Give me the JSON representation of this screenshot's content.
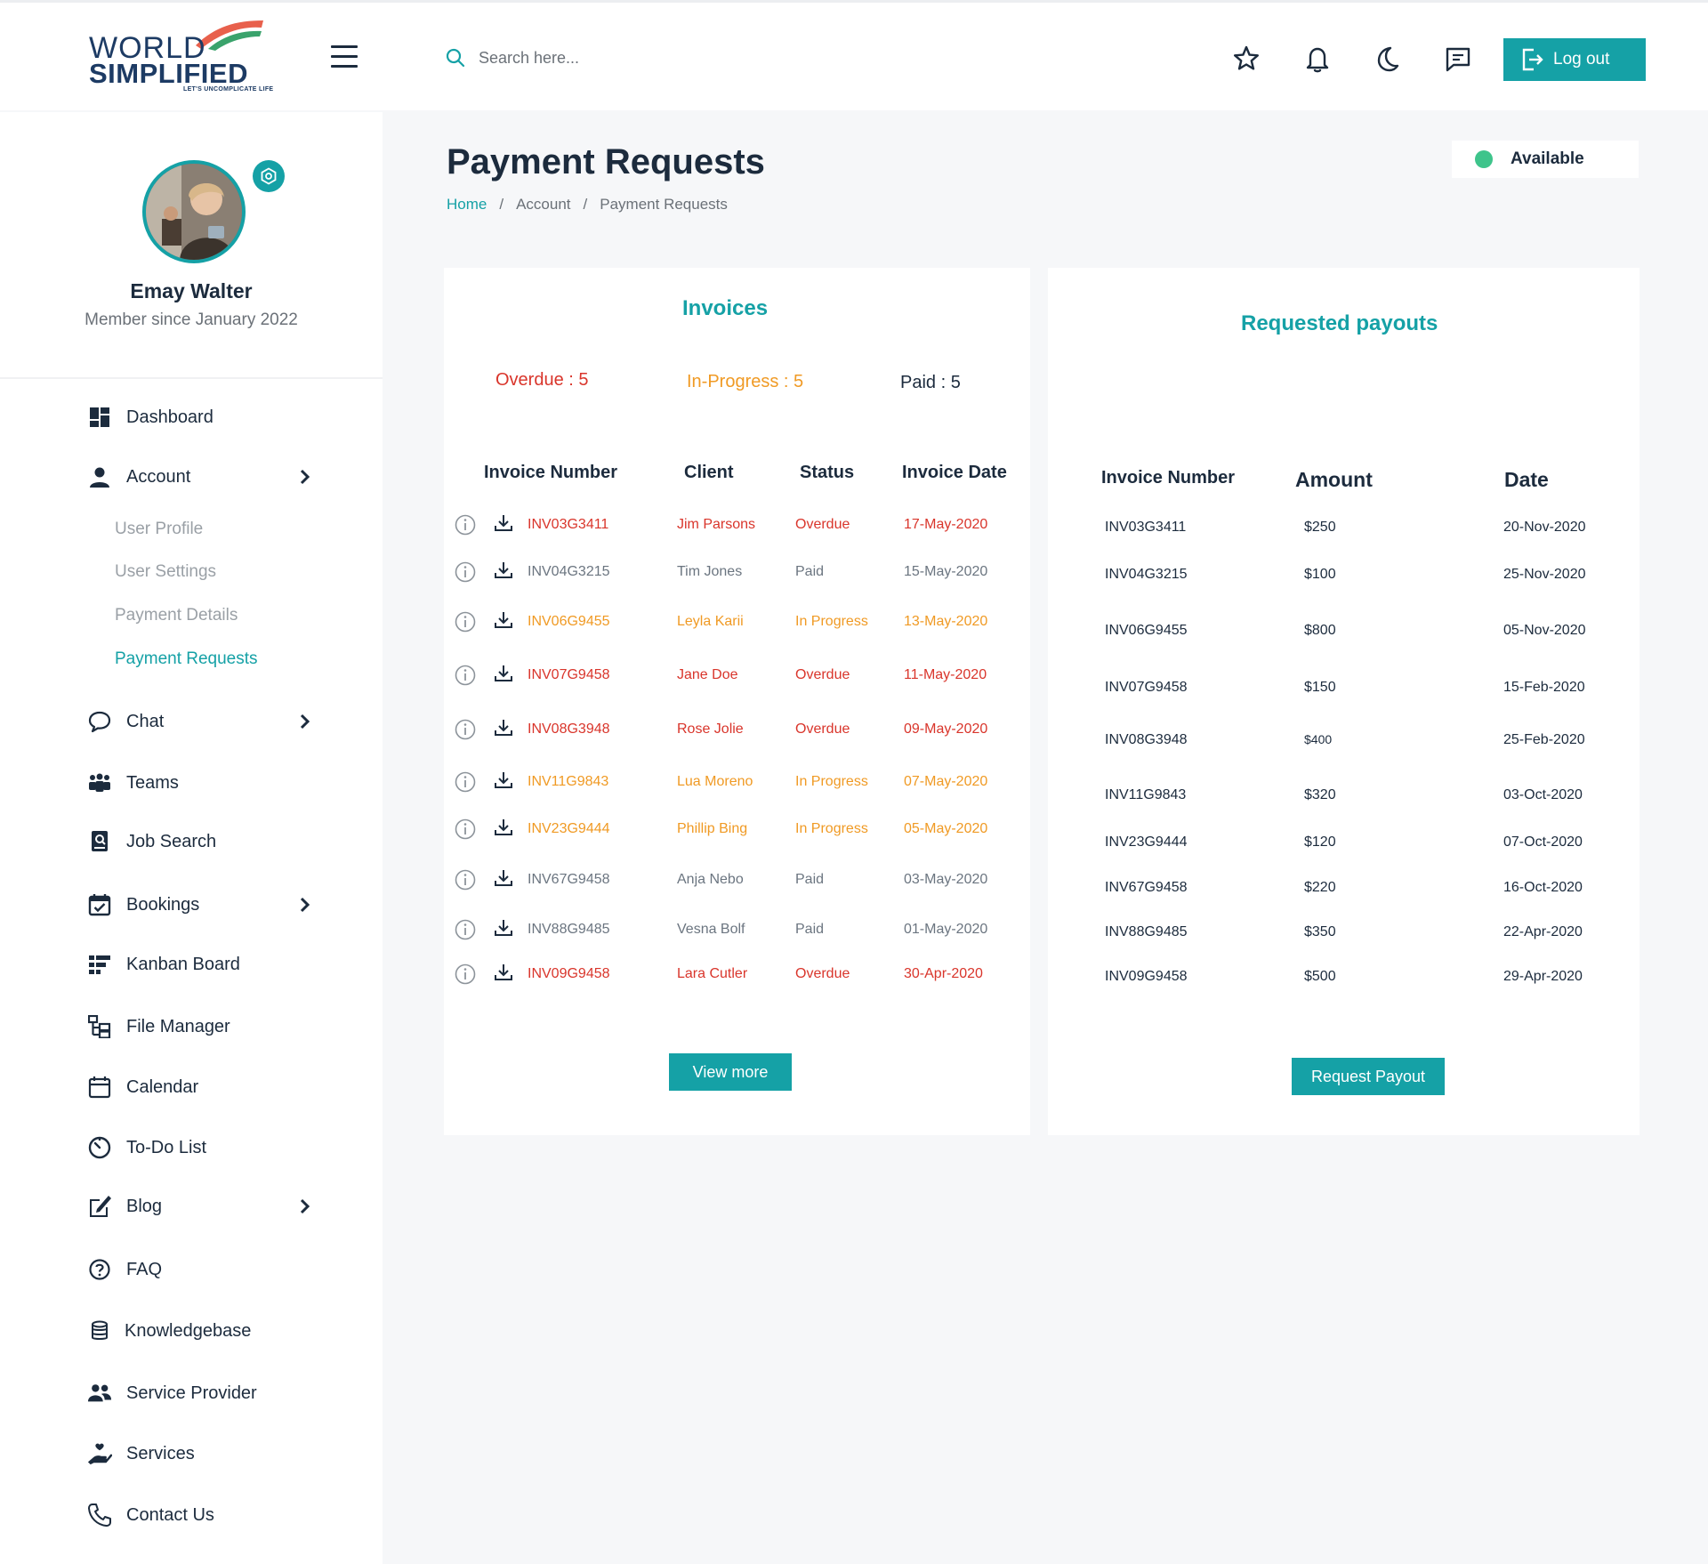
{
  "header": {
    "logo_world": "WORLD",
    "logo_simplified": "SIMPLIFIED",
    "logo_tagline": "LET'S UNCOMPLICATE LIFE",
    "search_placeholder": "Search here...",
    "logout_label": "Log out",
    "icons": [
      "menu-icon",
      "search-icon",
      "star-icon",
      "bell-icon",
      "moon-icon",
      "message-icon",
      "logout-icon"
    ]
  },
  "user": {
    "name": "Emay Walter",
    "since": "Member since January 2022"
  },
  "sidebar": {
    "items": [
      {
        "label": "Dashboard",
        "icon": "dashboard-icon"
      },
      {
        "label": "Account",
        "icon": "user-icon"
      },
      {
        "label": "Chat",
        "icon": "chat-icon"
      },
      {
        "label": "Teams",
        "icon": "teams-icon"
      },
      {
        "label": "Job Search",
        "icon": "job-search-icon"
      },
      {
        "label": "Bookings",
        "icon": "calendar-check-icon"
      },
      {
        "label": "Kanban Board",
        "icon": "kanban-icon"
      },
      {
        "label": "File Manager",
        "icon": "file-tree-icon"
      },
      {
        "label": "Calendar",
        "icon": "calendar-icon"
      },
      {
        "label": "To-Do List",
        "icon": "timer-icon"
      },
      {
        "label": "Blog",
        "icon": "edit-icon"
      },
      {
        "label": "FAQ",
        "icon": "help-icon"
      },
      {
        "label": "Knowledgebase",
        "icon": "database-icon"
      },
      {
        "label": "Service Provider",
        "icon": "people-icon"
      },
      {
        "label": "Services",
        "icon": "hand-heart-icon"
      },
      {
        "label": "Contact Us",
        "icon": "phone-icon"
      }
    ],
    "account_sub": [
      "User Profile",
      "User Settings",
      "Payment Details",
      "Payment Requests"
    ]
  },
  "page": {
    "title": "Payment Requests",
    "breadcrumb": [
      "Home",
      "Account",
      "Payment Requests"
    ],
    "status": "Available"
  },
  "invoices": {
    "title": "Invoices",
    "counts": {
      "overdue": "Overdue  : 5",
      "in_progress": "In-Progress : 5",
      "paid": "Paid  : 5"
    },
    "headers": [
      "Invoice Number",
      "Client",
      "Status",
      "Invoice Date"
    ],
    "rows": [
      {
        "number": "INV03G3411",
        "client": "Jim Parsons",
        "status": "Overdue",
        "date": "17-May-2020",
        "kind": "overdue"
      },
      {
        "number": "INV04G3215",
        "client": "Tim Jones",
        "status": "Paid",
        "date": "15-May-2020",
        "kind": "paid"
      },
      {
        "number": "INV06G9455",
        "client": "Leyla Karii",
        "status": "In Progress",
        "date": "13-May-2020",
        "kind": "progress"
      },
      {
        "number": "INV07G9458",
        "client": "Jane Doe",
        "status": "Overdue",
        "date": "11-May-2020",
        "kind": "overdue"
      },
      {
        "number": "INV08G3948",
        "client": "Rose Jolie",
        "status": "Overdue",
        "date": "09-May-2020",
        "kind": "overdue"
      },
      {
        "number": "INV11G9843",
        "client": "Lua Moreno",
        "status": "In Progress",
        "date": "07-May-2020",
        "kind": "progress"
      },
      {
        "number": "INV23G9444",
        "client": "Phillip Bing",
        "status": "In Progress",
        "date": "05-May-2020",
        "kind": "progress"
      },
      {
        "number": "INV67G9458",
        "client": "Anja Nebo",
        "status": "Paid",
        "date": "03-May-2020",
        "kind": "paid"
      },
      {
        "number": "INV88G9485",
        "client": "Vesna Bolf",
        "status": "Paid",
        "date": "01-May-2020",
        "kind": "paid"
      },
      {
        "number": "INV09G9458",
        "client": "Lara Cutler",
        "status": "Overdue",
        "date": "30-Apr-2020",
        "kind": "overdue"
      }
    ],
    "view_more": "View more"
  },
  "payouts": {
    "title": "Requested payouts",
    "headers": [
      "Invoice Number",
      "Amount",
      "Date"
    ],
    "rows": [
      {
        "number": "INV03G3411",
        "amount": "$250",
        "date": "20-Nov-2020"
      },
      {
        "number": "INV04G3215",
        "amount": "$100",
        "date": "25-Nov-2020"
      },
      {
        "number": "INV06G9455",
        "amount": "$800",
        "date": "05-Nov-2020"
      },
      {
        "number": "INV07G9458",
        "amount": "$150",
        "date": "15-Feb-2020"
      },
      {
        "number": "INV08G3948",
        "amount": "$400",
        "date": "25-Feb-2020"
      },
      {
        "number": "INV11G9843",
        "amount": "$320",
        "date": "03-Oct-2020"
      },
      {
        "number": "INV23G9444",
        "amount": "$120",
        "date": "07-Oct-2020"
      },
      {
        "number": "INV67G9458",
        "amount": "$220",
        "date": "16-Oct-2020"
      },
      {
        "number": "INV88G9485",
        "amount": "$350",
        "date": "22-Apr-2020"
      },
      {
        "number": "INV09G9458",
        "amount": "$500",
        "date": "29-Apr-2020"
      }
    ],
    "request_button": "Request Payout"
  },
  "colors": {
    "accent": "#15a1a6",
    "overdue": "#d9352b",
    "in_progress": "#f09a24",
    "paid": "#6b7580",
    "available": "#3ec48b",
    "navy": "#1c2b3d"
  }
}
